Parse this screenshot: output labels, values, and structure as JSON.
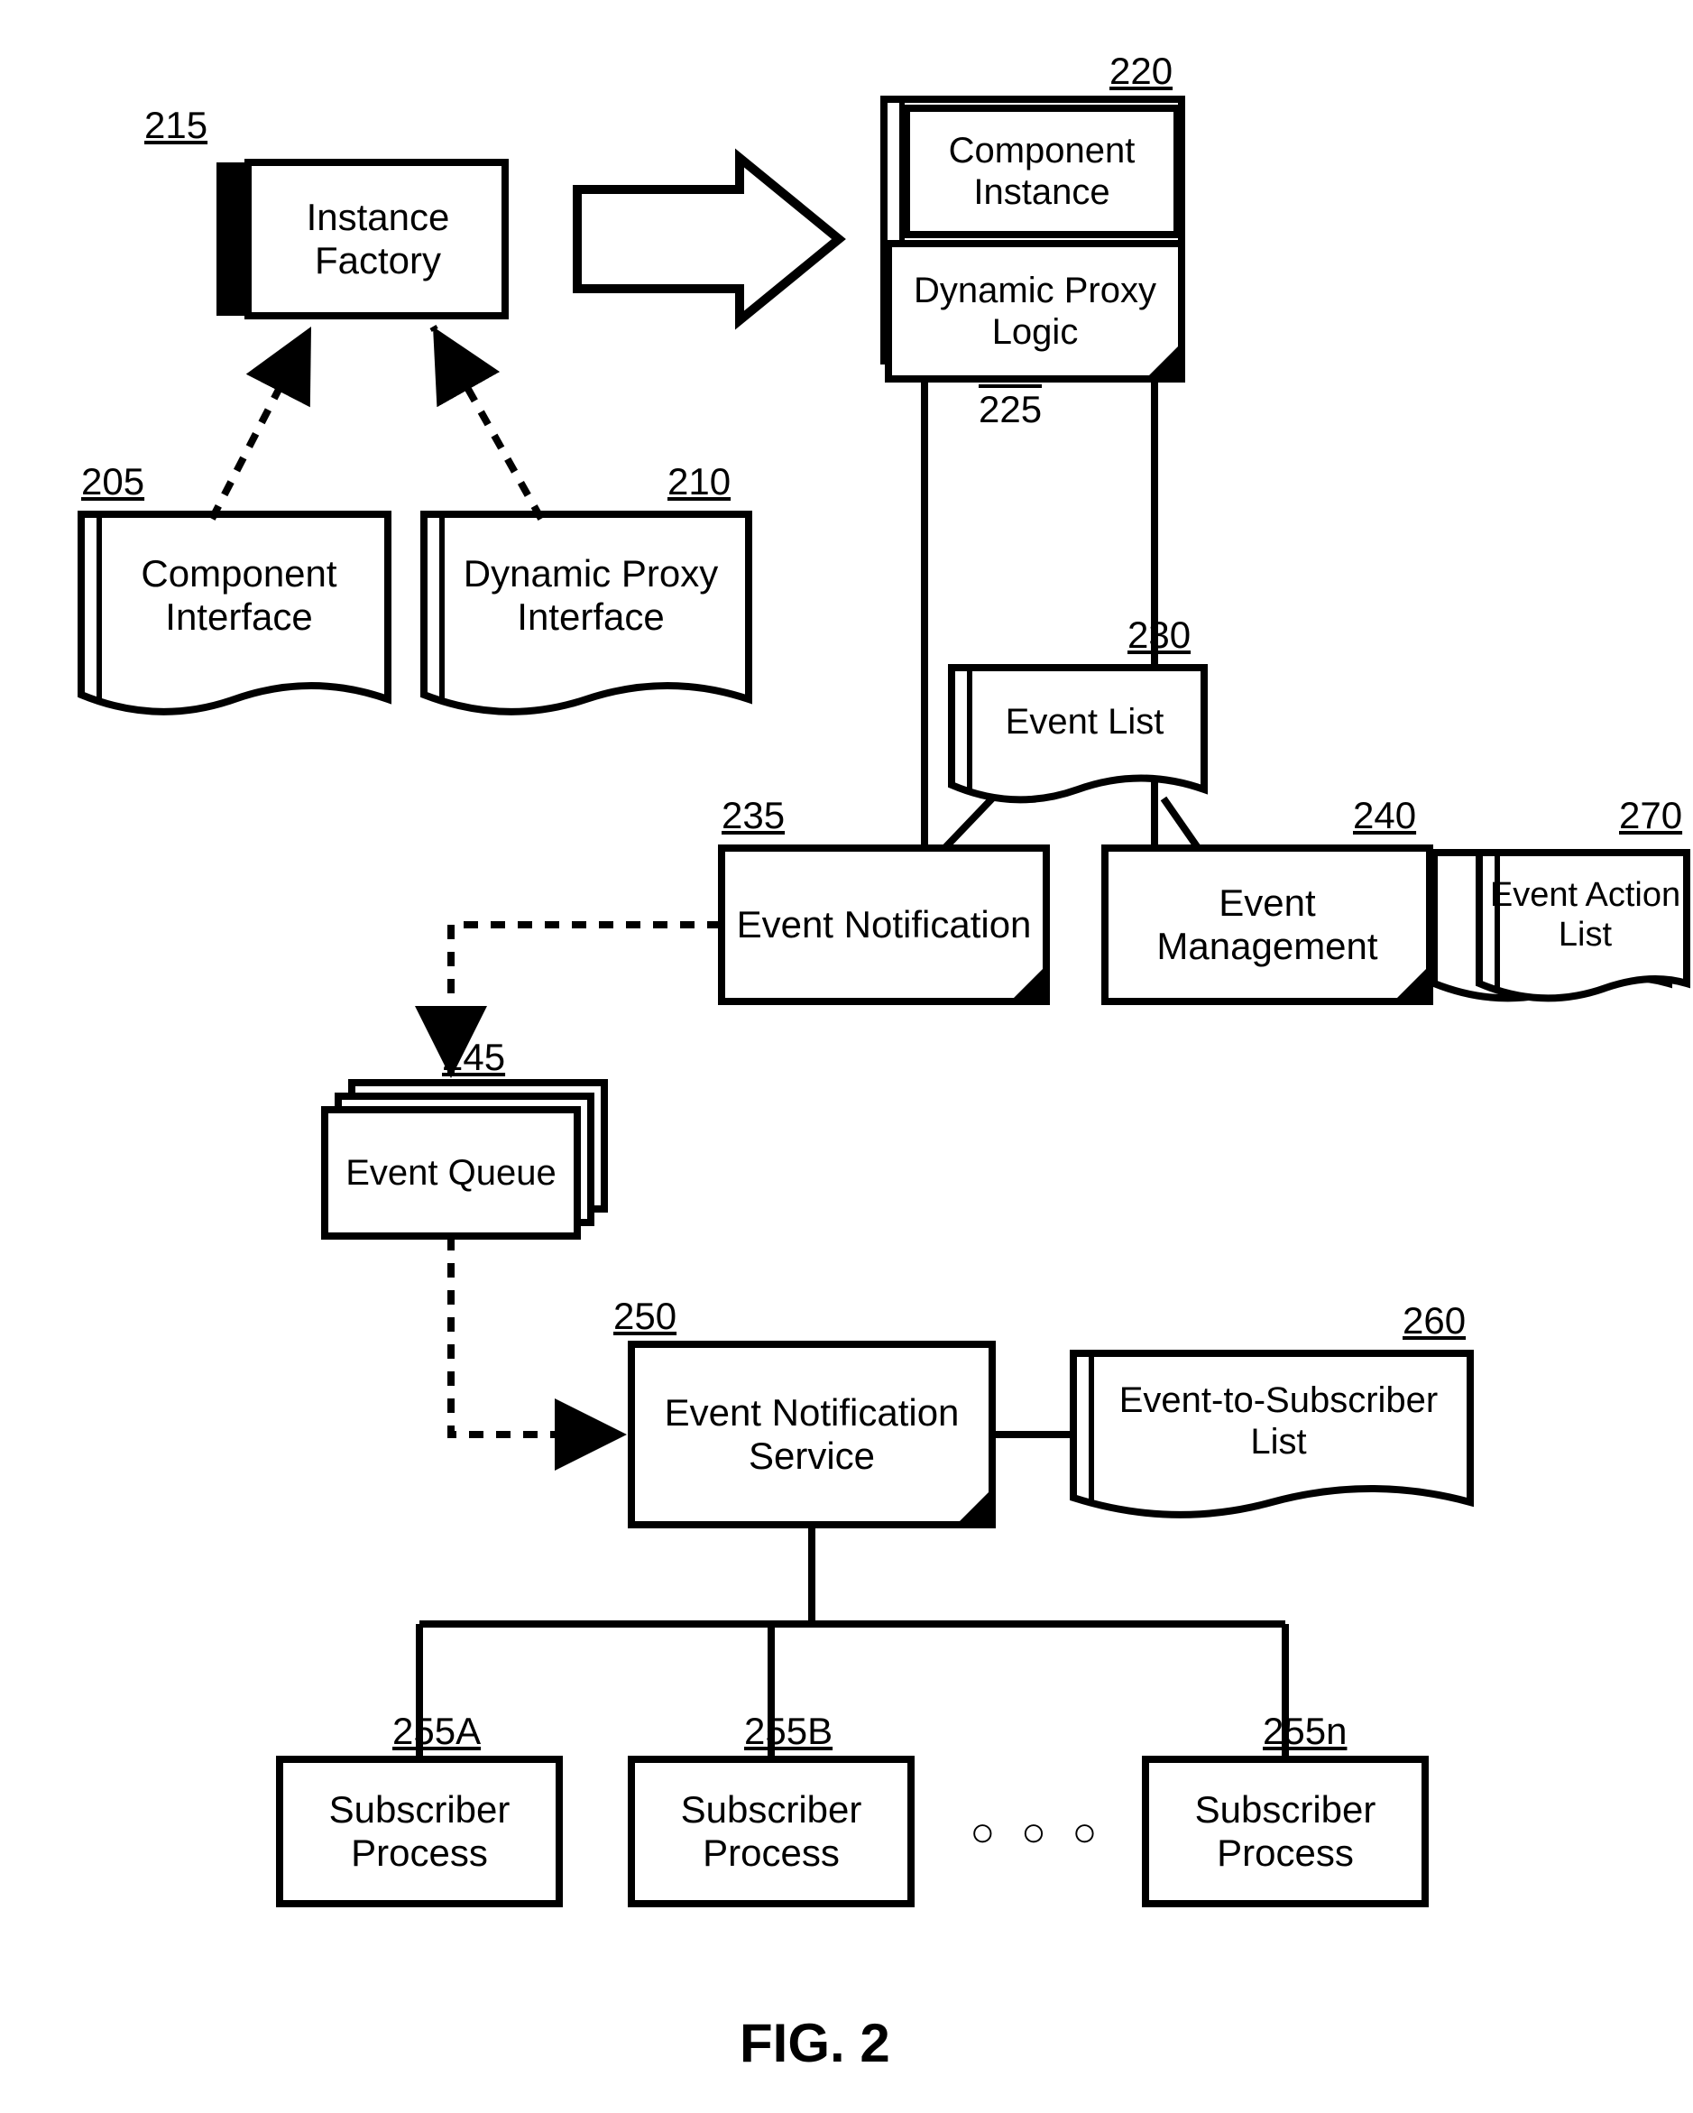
{
  "figure_label": "FIG. 2",
  "refs": {
    "component_interface": "205",
    "dynamic_proxy_interface": "210",
    "instance_factory": "215",
    "component_instance": "220",
    "dynamic_proxy_logic": "225",
    "event_list": "230",
    "event_notification": "235",
    "event_management": "240",
    "event_queue": "245",
    "event_notification_service": "250",
    "subscriber_a": "255A",
    "subscriber_b": "255B",
    "subscriber_n": "255n",
    "event_to_subscriber_list": "260",
    "event_action_list": "270"
  },
  "nodes": {
    "instance_factory": "Instance Factory",
    "component_interface": "Component Interface",
    "dynamic_proxy_interface": "Dynamic Proxy Interface",
    "component_instance": "Component Instance",
    "dynamic_proxy_logic": "Dynamic Proxy Logic",
    "event_list": "Event List",
    "event_notification": "Event Notification",
    "event_management": "Event Management",
    "event_action_list": "Event Action List",
    "event_queue": "Event Queue",
    "event_notification_service": "Event Notification Service",
    "event_to_subscriber_list": "Event-to-Subscriber List",
    "subscriber_a": "Subscriber Process",
    "subscriber_b": "Subscriber Process",
    "subscriber_n": "Subscriber Process",
    "ellipsis": "○ ○ ○"
  }
}
